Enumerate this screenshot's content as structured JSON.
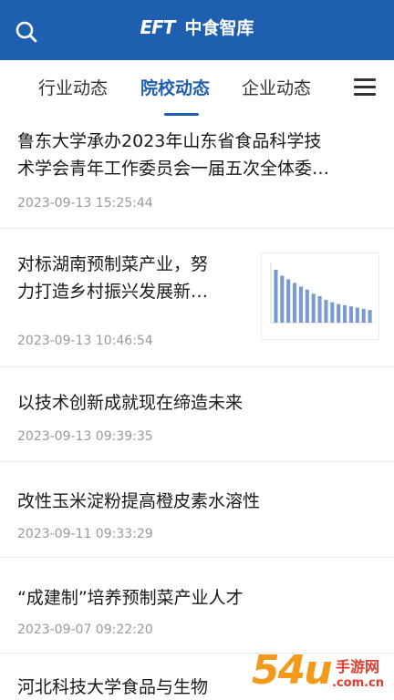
{
  "header": {
    "logo_text": "EFT",
    "app_name": "中食智库",
    "search_icon": "search-icon",
    "background": "#1f5fb0"
  },
  "tabs": [
    {
      "label": "行业动态",
      "active": false
    },
    {
      "label": "院校动态",
      "active": true
    },
    {
      "label": "企业动态",
      "active": false
    }
  ],
  "menu_icon": "hamburger-menu-icon",
  "articles": [
    {
      "title_line1": "鲁东大学承办2023年山东省食品科学技",
      "title_line2": "术学会青年工作委员会一届五次全体委…",
      "date": "2023-09-13 15:25:44",
      "has_thumb": false
    },
    {
      "title_line1": "对标湖南预制菜产业，努",
      "title_line2": "力打造乡村振兴发展新…",
      "date": "2023-09-13 10:46:54",
      "has_thumb": true
    },
    {
      "title_line1": "以技术创新成就现在缔造未来",
      "title_line2": "",
      "date": "2023-09-13 09:39:35",
      "has_thumb": false
    },
    {
      "title_line1": "改性玉米淀粉提高橙皮素水溶性",
      "title_line2": "",
      "date": "2023-09-11 09:33:29",
      "has_thumb": false
    },
    {
      "title_line1": "“成建制”培养预制菜产业人才",
      "title_line2": "",
      "date": "2023-09-07 09:22:20",
      "has_thumb": false
    },
    {
      "title_line1": "河北科技大学食品与生物",
      "title_line2": "",
      "date": "",
      "has_thumb": false
    }
  ],
  "watermark": {
    "number": "54u",
    "text": "手游网",
    "url": ".com.cn"
  },
  "thumbnail_chart": {
    "type": "bar",
    "values": [
      88,
      78,
      72,
      66,
      60,
      55,
      48,
      44,
      38,
      34,
      31,
      29,
      27,
      25,
      23,
      21
    ]
  }
}
